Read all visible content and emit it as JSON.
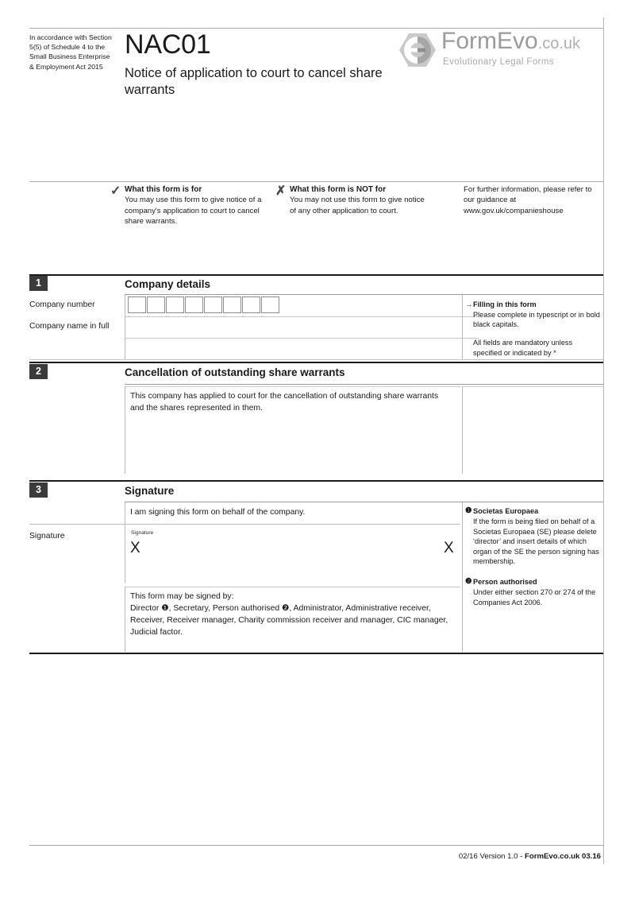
{
  "document": {
    "accordance_note": "In accordance with Section 5(5) of Schedule 4 to the Small Business Enterprise & Employment Act 2015",
    "form_code": "NAC01",
    "form_title": "Notice of application to court to cancel share warrants"
  },
  "logo": {
    "brand": "FormEvo",
    "tld": ".co.uk",
    "tagline": "Evolutionary Legal Forms",
    "icon": "hexagon-arrows-icon",
    "color": "#9b9b9b"
  },
  "info_band": {
    "for": {
      "mark": "check-icon",
      "heading": "What this form is for",
      "body": "You may use this form to give notice of a company's application to court to cancel share warrants."
    },
    "not_for": {
      "mark": "cross-icon",
      "heading": "What this form is NOT for",
      "body": "You may not use this form to give notice of any other application to court."
    },
    "further": {
      "body": "For further information, please refer to our guidance at www.gov.uk/companieshouse"
    }
  },
  "sections": [
    {
      "number": "1",
      "title": "Company details",
      "fields": [
        {
          "label": "Company number",
          "type": "boxes",
          "cells": 8,
          "value": ""
        },
        {
          "label": "Company name in full",
          "type": "lines",
          "lines": 2,
          "value": ""
        }
      ]
    },
    {
      "number": "2",
      "title": "Cancellation of outstanding share warrants",
      "statement": "This company has applied to court for the cancellation of outstanding share warrants and the shares represented in them."
    },
    {
      "number": "3",
      "title": "Signature",
      "statement": "I am signing this form on behalf of the company.",
      "signature_label": "Signature",
      "signature_caption": "Signature",
      "signature_mark": "X",
      "signed_by_intro": "This form may be signed by:",
      "signed_by_list": "Director ❶, Secretary, Person authorised ❷, Administrator, Administrative receiver, Receiver, Receiver manager, Charity commission receiver and manager, CIC manager, Judicial factor."
    }
  ],
  "guidance": {
    "filling_in": {
      "arrow": "arrow-right-icon",
      "heading": "Filling in this form",
      "para1": "Please complete in typescript or in bold black capitals.",
      "para2": "All fields are mandatory unless specified or indicated by *"
    },
    "note1": {
      "marker": "❶",
      "heading": "Societas Europaea",
      "body": "If the form is being filed on behalf of a Societas Europaea (SE) please delete ‘director’ and insert details of which organ of the SE the person signing has membership."
    },
    "note2": {
      "marker": "❷",
      "heading": "Person authorised",
      "body": "Under either section 270 or 274 of the Companies Act 2006."
    }
  },
  "footer": {
    "version": "02/16 Version 1.0 - ",
    "brand": "FormEvo.co.uk 03.16"
  }
}
